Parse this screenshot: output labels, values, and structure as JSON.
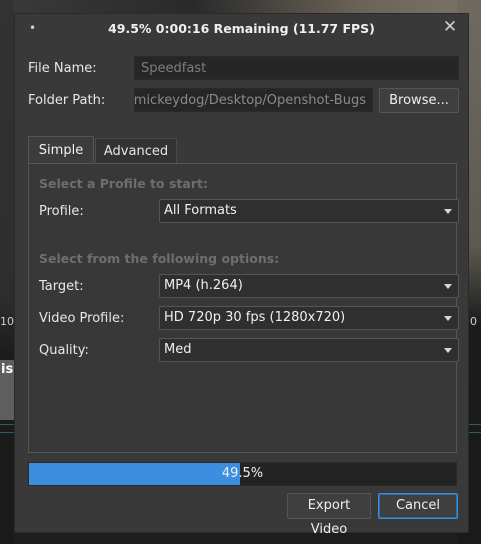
{
  "title": {
    "text": "49.5%  0:00:16 Remaining (11.77 FPS)",
    "dot": "•",
    "close": "✕"
  },
  "background": {
    "tick_left": "10",
    "tick_right": "0",
    "clip_text": "is"
  },
  "file_name": {
    "label": "File Name:",
    "value": "Speedfast"
  },
  "folder_path": {
    "label": "Folder Path:",
    "value": "e/mickeydog/Desktop/Openshot-Bugs",
    "browse_label": "Browse..."
  },
  "tabs": [
    {
      "label": "Simple",
      "active": true
    },
    {
      "label": "Advanced",
      "active": false
    }
  ],
  "simple": {
    "profile_section": "Select a Profile to start:",
    "profile_label": "Profile:",
    "profile_value": "All Formats",
    "options_section": "Select from the following options:",
    "target_label": "Target:",
    "target_value": "MP4 (h.264)",
    "video_profile_label": "Video Profile:",
    "video_profile_value": "HD 720p 30 fps (1280x720)",
    "quality_label": "Quality:",
    "quality_value": "Med"
  },
  "progress": {
    "percent": 49.5,
    "text": "49.5%"
  },
  "buttons": {
    "export": "Export Video",
    "cancel": "Cancel"
  },
  "colors": {
    "accent": "#3d8ee0",
    "dialog_bg": "#393939"
  }
}
